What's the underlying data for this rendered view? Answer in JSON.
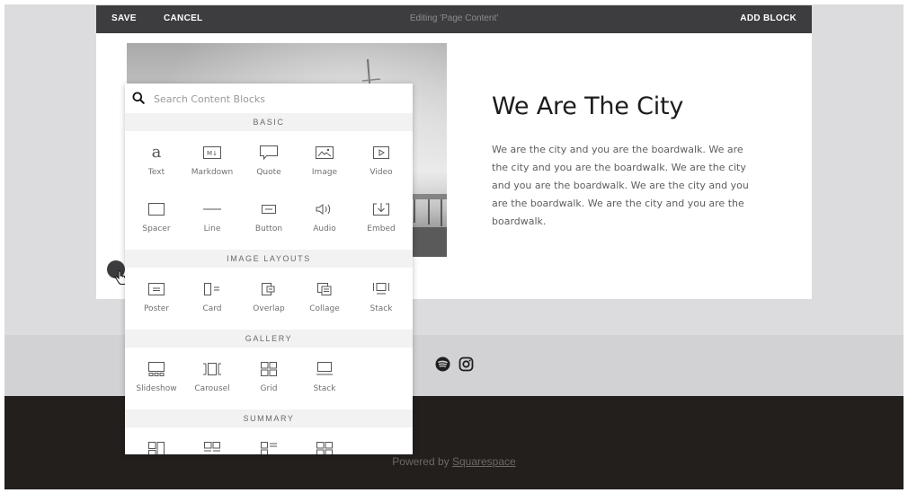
{
  "toolbar": {
    "save": "SAVE",
    "cancel": "CANCEL",
    "status": "Editing 'Page Content'",
    "add_block": "ADD BLOCK"
  },
  "article": {
    "title": "We Are The City",
    "body": "We are the city and you are the boardwalk. We are the city and you are the boardwalk. We are the city and you are the boardwalk. We are the city and you are the boardwalk. We are the city and you are the boardwalk."
  },
  "panel": {
    "search_placeholder": "Search Content Blocks",
    "sections": {
      "basic": "BASIC",
      "image_layouts": "IMAGE LAYOUTS",
      "gallery": "GALLERY",
      "summary": "SUMMARY"
    },
    "basic": [
      "Text",
      "Markdown",
      "Quote",
      "Image",
      "Video",
      "Spacer",
      "Line",
      "Button",
      "Audio",
      "Embed"
    ],
    "image_layouts": [
      "Poster",
      "Card",
      "Overlap",
      "Collage",
      "Stack"
    ],
    "gallery": [
      "Slideshow",
      "Carousel",
      "Grid",
      "Stack"
    ],
    "icons": {
      "basic": [
        "text-icon",
        "markdown-icon",
        "quote-icon",
        "image-icon",
        "video-icon",
        "spacer-icon",
        "line-icon",
        "button-icon",
        "audio-icon",
        "embed-icon"
      ],
      "image_layouts": [
        "poster-icon",
        "card-icon",
        "overlap-icon",
        "collage-icon",
        "stack-icon"
      ],
      "gallery": [
        "slideshow-icon",
        "carousel-icon",
        "grid-icon",
        "stack-icon"
      ],
      "summary": [
        "summary-wall-icon",
        "summary-carousel-icon",
        "summary-list-icon",
        "summary-grid-icon"
      ]
    }
  },
  "footer": {
    "social_icons": [
      "spotify-icon",
      "instagram-icon"
    ],
    "powered_prefix": "Powered by ",
    "powered_link": "Squarespace"
  },
  "colors": {
    "toolbar": "#3d3c3f",
    "footer_dark": "#231f1d",
    "footer_light": "#d2d1d4",
    "page_bg": "#dcdcde"
  }
}
